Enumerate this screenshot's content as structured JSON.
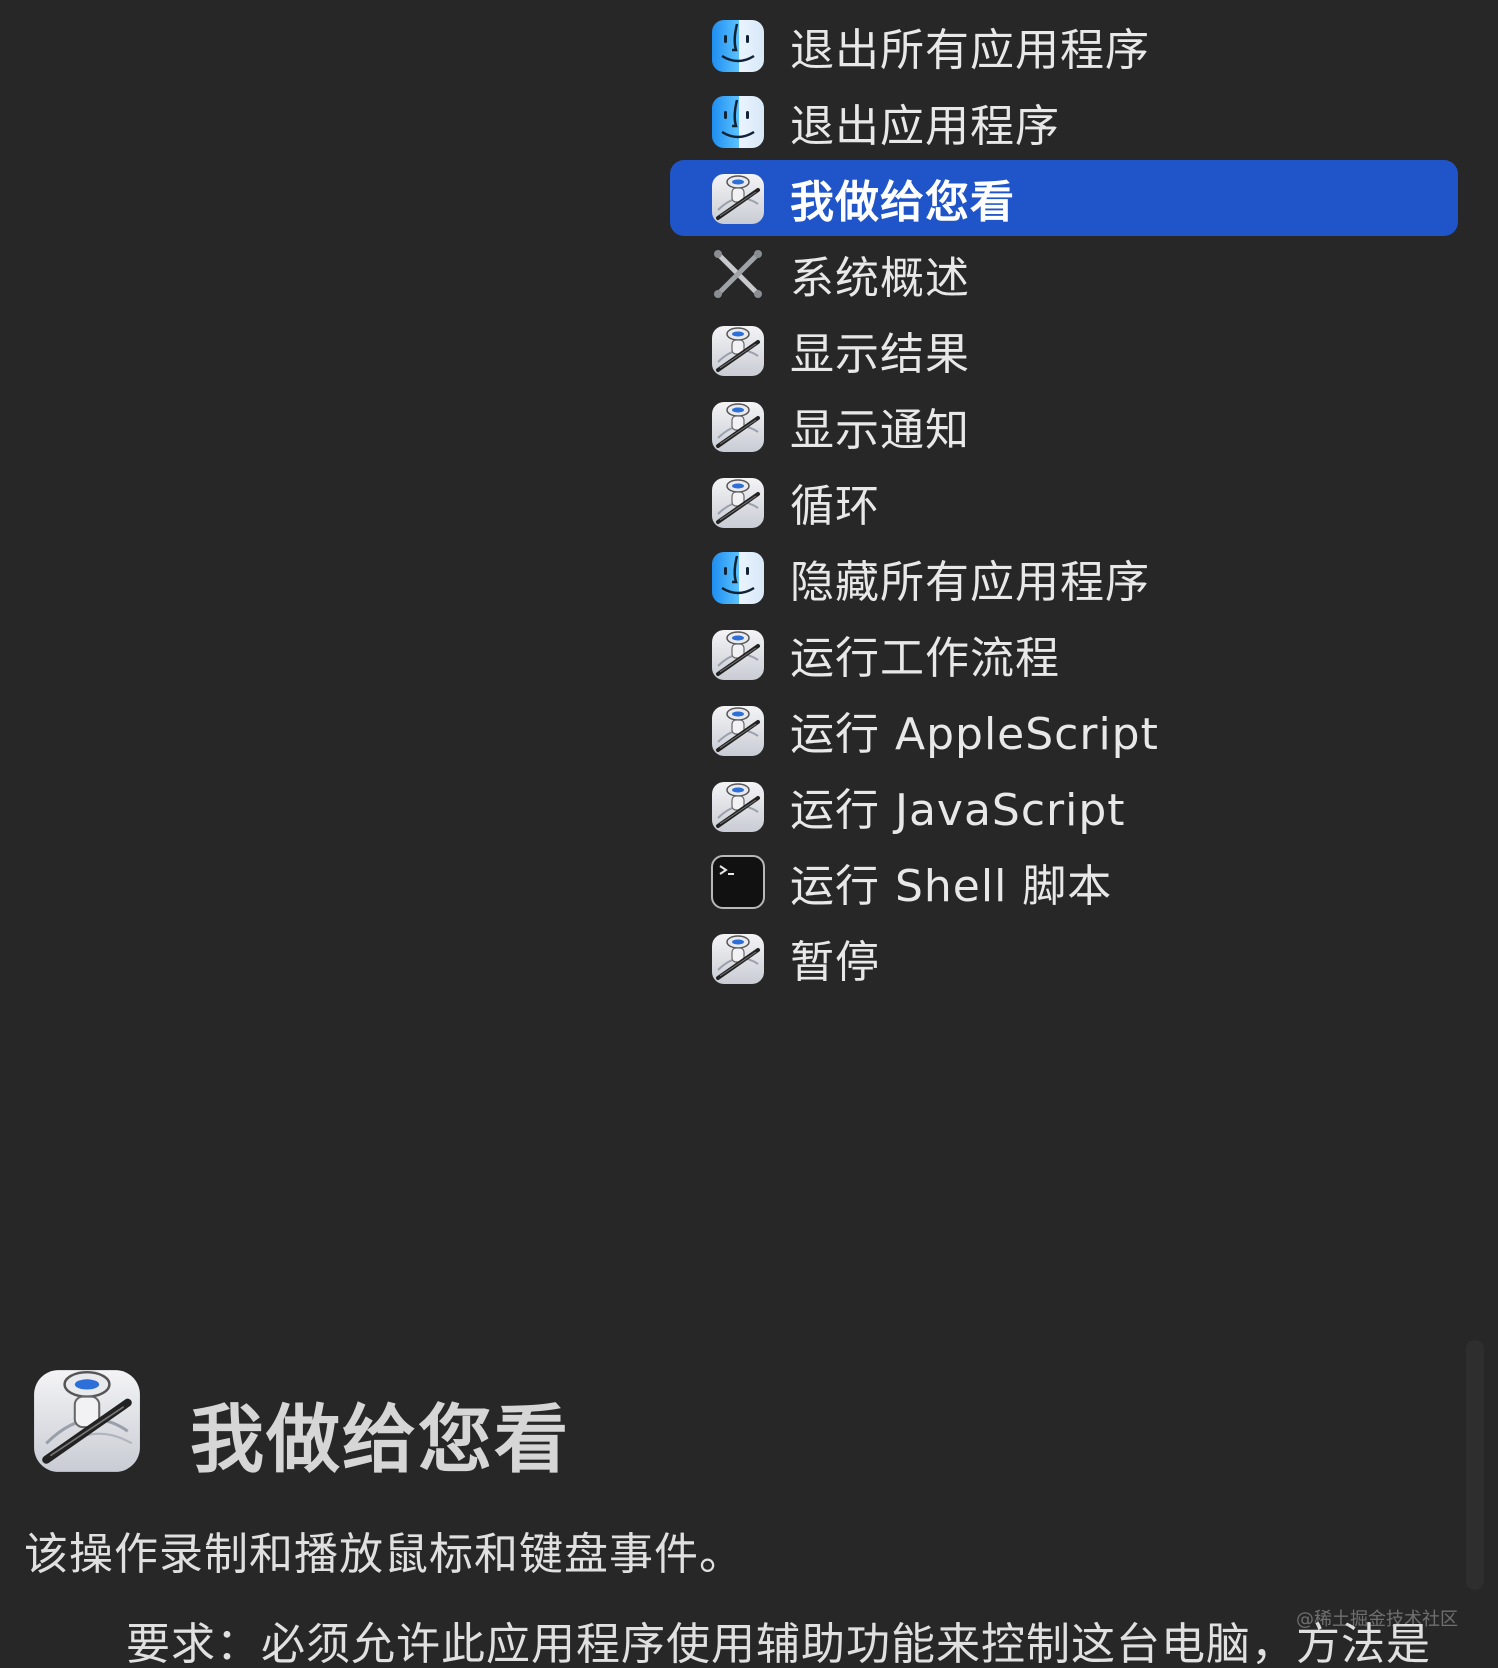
{
  "action_list": {
    "items": [
      {
        "label": "退出所有应用程序",
        "icon": "finder-icon"
      },
      {
        "label": "退出应用程序",
        "icon": "finder-icon"
      },
      {
        "label": "我做给您看",
        "icon": "automator-icon",
        "selected": true
      },
      {
        "label": "系统概述",
        "icon": "system-tools-icon"
      },
      {
        "label": "显示结果",
        "icon": "automator-icon"
      },
      {
        "label": "显示通知",
        "icon": "automator-icon"
      },
      {
        "label": "循环",
        "icon": "automator-icon"
      },
      {
        "label": "隐藏所有应用程序",
        "icon": "finder-icon"
      },
      {
        "label": "运行工作流程",
        "icon": "automator-icon"
      },
      {
        "label": "运行 AppleScript",
        "icon": "automator-icon"
      },
      {
        "label": "运行 JavaScript",
        "icon": "automator-icon"
      },
      {
        "label": "运行 Shell 脚本",
        "icon": "terminal-icon"
      },
      {
        "label": "暂停",
        "icon": "automator-icon"
      }
    ]
  },
  "detail": {
    "title": "我做给您看",
    "description": "该操作录制和播放鼠标和键盘事件。",
    "requirement": "要求：必须允许此应用程序使用辅助功能来控制这台电脑，方法是"
  },
  "watermark": "@稀土掘金技术社区",
  "colors": {
    "background": "#272727",
    "selection": "#1f55c8",
    "text": "#e8e8e8"
  }
}
